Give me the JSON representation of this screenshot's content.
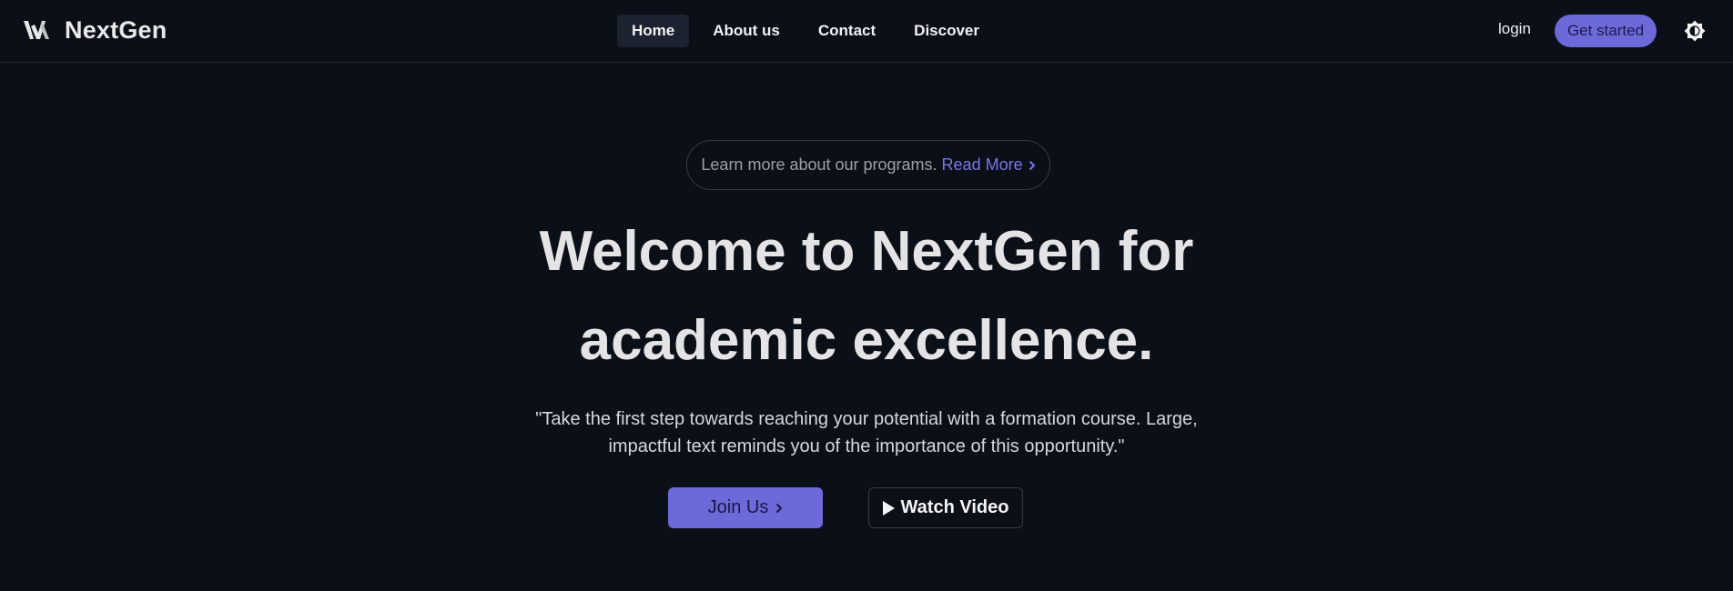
{
  "brand": {
    "name": "NextGen",
    "icon": "logo-icon"
  },
  "nav": {
    "items": [
      {
        "label": "Home",
        "active": true
      },
      {
        "label": "About us"
      },
      {
        "label": "Contact"
      },
      {
        "label": "Discover"
      }
    ],
    "login_label": "login",
    "get_started_label": "Get started",
    "theme_toggle_icon": "theme-toggle-icon"
  },
  "hero": {
    "announcement_text": "Learn more about our programs.",
    "announcement_link": "Read More",
    "title": "Welcome to NextGen for academic excellence.",
    "subtitle": "\"Take the first step towards reaching your potential with a formation course. Large, impactful text reminds you of the importance of this opportunity.\"",
    "join_label": "Join Us",
    "video_label": "Watch Video"
  },
  "colors": {
    "background": "#0b0f17",
    "accent": "#6c69d9",
    "link": "#7a78ea"
  }
}
